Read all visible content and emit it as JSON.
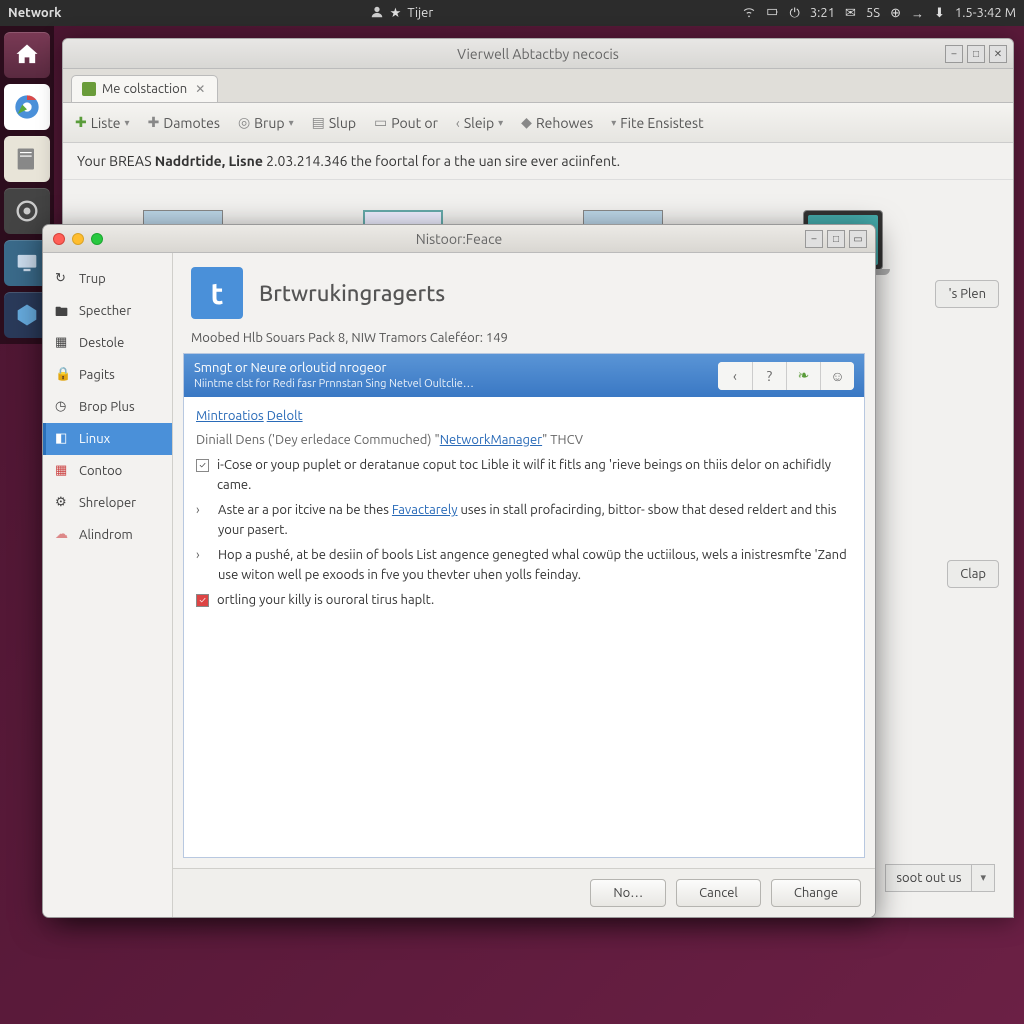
{
  "topbar": {
    "left_label": "Network",
    "user": "Tijer",
    "time": "3:21",
    "extra": "1.5-3:42 M",
    "mail_count": "5S"
  },
  "main_window": {
    "title": "Vierwell Abtactby necocis",
    "tab_label": "Me colstaction",
    "toolbar": {
      "liste": "Liste",
      "damotes": "Damotes",
      "brup": "Brup",
      "slup": "Slup",
      "poutor": "Pout or",
      "sleip": "Sleip",
      "rehowes": "Rehowes",
      "fite": "Fite Ensistest"
    },
    "banner_pre": "Your BREAS ",
    "banner_bold": "Naddrtide, Lisne",
    "banner_post": " 2.03.214.346 the foortal for a the uan sire ever aciinfent.",
    "btn_splen": "'s Plen",
    "btn_clap": "Clap",
    "btn_sootout": "soot out us"
  },
  "dialog": {
    "title": "Nistoor:Feace",
    "sidebar": {
      "trup": "Trup",
      "specther": "Specther",
      "destole": "Destole",
      "pagits": "Pagits",
      "brop_plus": "Brop Plus",
      "linux": "Linux",
      "contoo": "Contoo",
      "shreloper": "Shreloper",
      "alindrom": "Alindrom"
    },
    "app_title": "Brtwrukingragerts",
    "sub_line": "Moobed Hlb Souars Pack 8, NIW Tramors Caleféor: 149",
    "list_header_title": "Smngt or Neure orloutid nrogeor",
    "list_header_sub": "Niintme clst for Redi fasr Prnnstan Sing Netvel Oultclie…",
    "content": {
      "link1": "Mintroatios",
      "link2": "Delolt",
      "line2_pre": "Diniall Dens ('Dey erledace Commuched) \"",
      "line2_link": "NetworkManager",
      "line2_post": "\" THCV",
      "body1": "i-Cose or youp puplet or deratanue coput toc Lible it wilf it fitls ang 'rieve beings on thiis delor on achifidly came.",
      "body2_pre": "Aste ar a por itcive na be thes ",
      "body2_link": "Favactarely",
      "body2_post": " uses in stall profacirding, bittor- sbow that desed reldert and this your pasert.",
      "body3": "Hop a pushé, at be desiin of bools List angence genegted whal cowüp the uctiilous, wels a inistresmfte 'Zand use witon well pe exoods in fve you thevter uhen yolls feinday.",
      "body4": "ortling your killy is ouroral tirus haplt."
    },
    "footer": {
      "no": "No…",
      "cancel": "Cancel",
      "change": "Change"
    }
  }
}
